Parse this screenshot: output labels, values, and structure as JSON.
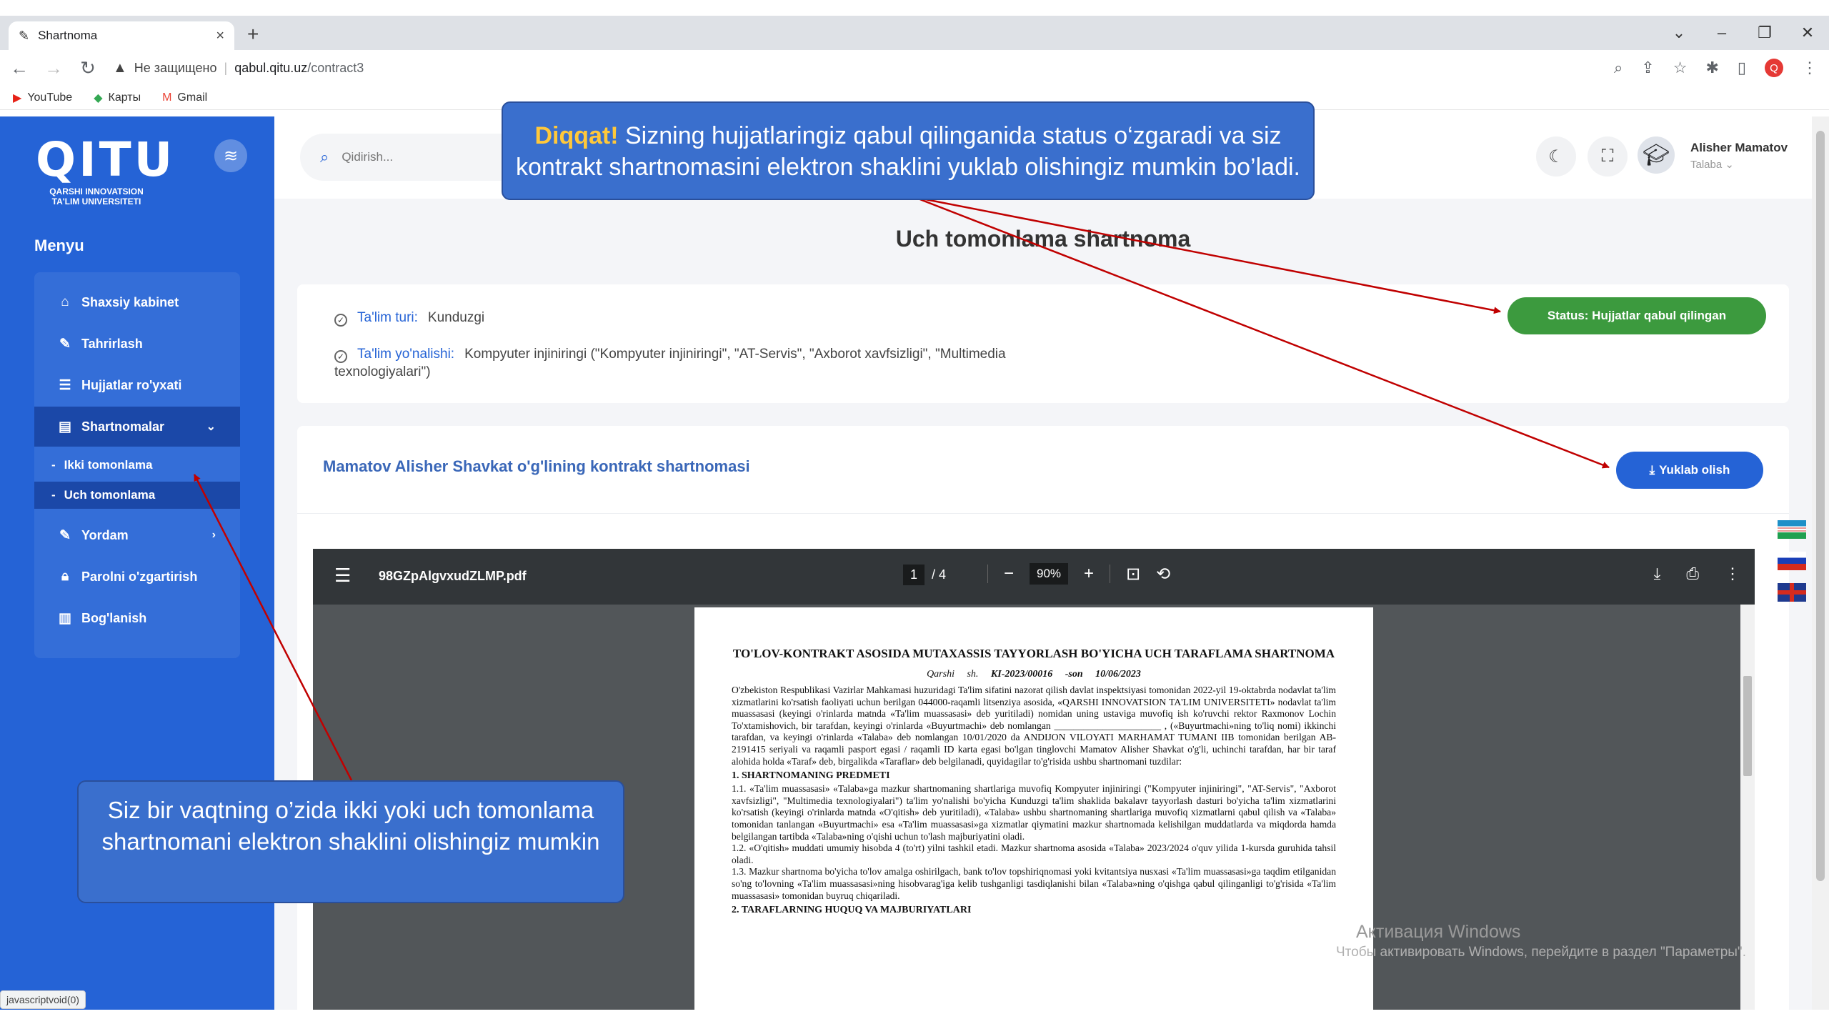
{
  "browser": {
    "tab_title": "Shartnoma",
    "insecure_label": "Не защищено",
    "url_host": "qabul.qitu.uz",
    "url_path": "/contract3",
    "bookmarks": [
      "YouTube",
      "Карты",
      "Gmail"
    ],
    "profile_letter": "Q",
    "status_url": "javascriptvoid(0)"
  },
  "brand": {
    "logo": "QITU",
    "subtitle": "QARSHI INNOVATSION TA'LIM UNIVERSITETI"
  },
  "sidebar": {
    "menu_title": "Menyu",
    "items": [
      {
        "label": "Shaxsiy kabinet",
        "icon": "home-icon"
      },
      {
        "label": "Tahrirlash",
        "icon": "edit-icon"
      },
      {
        "label": "Hujjatlar ro'yxati",
        "icon": "list-icon"
      },
      {
        "label": "Shartnomalar",
        "icon": "document-icon"
      },
      {
        "label": "Ikki tomonlama"
      },
      {
        "label": "Uch tomonlama"
      },
      {
        "label": "Yordam",
        "icon": "help-icon"
      },
      {
        "label": "Parolni o'zgartirish",
        "icon": "lock-icon"
      },
      {
        "label": "Bog'lanish",
        "icon": "map-icon"
      }
    ]
  },
  "header": {
    "search_placeholder": "Qidirish...",
    "user_name": "Alisher Mamatov",
    "user_role": "Talaba"
  },
  "main": {
    "title": "Uch tomonlama shartnoma",
    "study_type_label": "Ta'lim turi:",
    "study_type_value": "Kunduzgi",
    "direction_label": "Ta'lim yo'nalishi:",
    "direction_value": "Kompyuter injiniringi (\"Kompyuter injiniringi\", \"AT-Servis\", \"Axborot xavfsizligi\", \"Multimedia",
    "direction_value_cont": "texnologiyalari\")",
    "status_button": "Status: Hujjatlar qabul qilingan",
    "contract_title": "Mamatov Alisher Shavkat o'g'lining kontrakt shartnomasi",
    "download_button": "Yuklab olish"
  },
  "pdf": {
    "filename": "98GZpAlgvxudZLMP.pdf",
    "page_current": "1",
    "page_total": "/ 4",
    "zoom": "90%",
    "doc_title": "TO'LOV-KONTRAKT ASOSIDA MUTAXASSIS TAYYORLASH BO'YICHA UCH TARAFLAMA SHARTNOMA",
    "doc_city": "Qarshi sh.",
    "doc_number": "KI-2023/00016 -son",
    "doc_date": "10/06/2023",
    "para1": "O'zbekiston Respublikasi Vazirlar Mahkamasi huzuridagi Ta'lim sifatini nazorat qilish davlat inspektsiyasi tomonidan 2022-yil 19-oktabrda nodavlat ta'lim xizmatlarini ko'rsatish faoliyati uchun berilgan 044000-raqamli litsenziya asosida, «QARSHI INNOVATSION TA'LIM UNIVERSITETI» nodavlat ta'lim muassasasi (keyingi o'rinlarda matnda «Ta'lim muassasasi» deb yuritiladi) nomidan uning ustaviga muvofiq ish ko'ruvchi rektor Raxmonov Lochin To'xtamishovich, bir tarafdan, keyingi o'rinlarda «Buyurtmachi» deb nomlangan ______________________ , («Buyurtmachi»ning to'liq nomi) ikkinchi tarafdan, va keyingi o'rinlarda «Talaba» deb nomlangan 10/01/2020 da ANDIJON VILOYATI MARHAMAT TUMANI IIB tomonidan berilgan AB-2191415 seriyali va raqamli pasport egasi / raqamli ID karta egasi bo'lgan tinglovchi Mamatov Alisher Shavkat o'g'li, uchinchi tarafdan, har bir taraf alohida holda «Taraf» deb, birgalikda «Taraflar» deb belgilanadi, quyidagilar to'g'risida ushbu shartnomani tuzdilar:",
    "heading1": "1. SHARTNOMANING PREDMETI",
    "para2": "1.1. «Ta'lim muassasasi» «Talaba»ga mazkur shartnomaning shartlariga muvofiq Kompyuter injiniringi (\"Kompyuter injiniringi\", \"AT-Servis\", \"Axborot xavfsizligi\", \"Multimedia texnologiyalari\") ta'lim yo'nalishi bo'yicha Kunduzgi ta'lim shaklida bakalavr tayyorlash dasturi bo'yicha ta'lim xizmatlarini ko'rsatish (keyingi o'rinlarda matnda «O'qitish» deb yuritiladi), «Talaba» ushbu shartnomaning shartlariga muvofiq xizmatlarni qabul qilish va «Talaba» tomonidan tanlangan «Buyurtmachi» esa «Ta'lim muassasasi»ga xizmatlar qiymatini mazkur shartnomada kelishilgan muddatlarda va miqdorda hamda belgilangan tartibda «Talaba»ning o'qishi uchun to'lash majburiyatini oladi.",
    "para3": "1.2. «O'qitish» muddati umumiy hisobda 4 (to'rt) yilni tashkil etadi. Mazkur shartnoma asosida «Talaba» 2023/2024 o'quv yilida 1-kursda guruhida tahsil oladi.",
    "para4": "1.3. Mazkur shartnoma bo'yicha to'lov amalga oshirilgach, bank to'lov topshiriqnomasi yoki kvitantsiya nusxasi «Ta'lim muassasasi»ga taqdim etilganidan so'ng to'lovning «Ta'lim muassasasi»ning hisobvarag'iga kelib tushganligi tasdiqlanishi bilan «Talaba»ning o'qishga qabul qilinganligi to'g'risida «Ta'lim muassasasi» tomonidan buyruq chiqariladi.",
    "heading2": "2. TARAFLARNING HUQUQ VA MAJBURIYATLARI"
  },
  "os": {
    "watermark_title": "Активация Windows",
    "watermark_text": "Чтобы активировать Windows, перейдите в раздел \"Параметры\"."
  },
  "annotations": {
    "top_highlight": "Diqqat!",
    "top_line1": " Sizning hujjatlaringiz qabul qilinganida status o‘zgaradi va siz",
    "top_line2": "kontrakt shartnomasini elektron shaklini yuklab olishingiz mumkin bo’ladi.",
    "left_text": "Siz bir vaqtning o’zida ikki yoki uch tomonlama shartnomani elektron shaklini olishingiz mumkin",
    "arrow_color": "#c00000"
  },
  "colors": {
    "sidebar": "#2563d6",
    "sidebar_active": "#1b48a8",
    "status_green": "#3c9a3e",
    "download_blue": "#2563d6"
  }
}
